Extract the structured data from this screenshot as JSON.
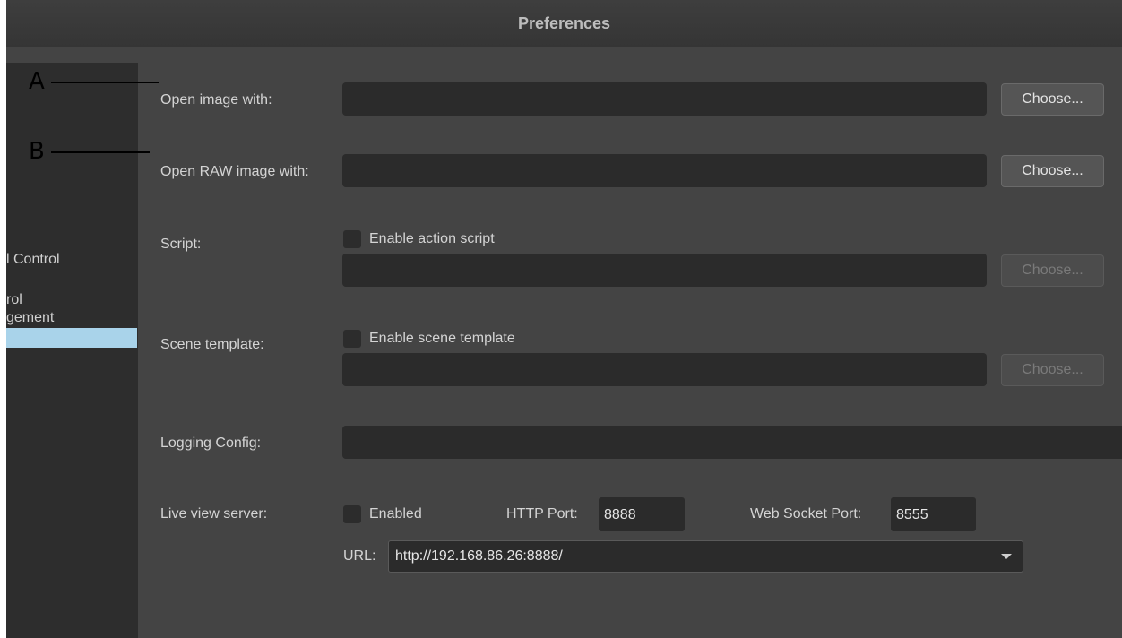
{
  "window": {
    "title": "Preferences"
  },
  "sidebar": {
    "items": [
      "l Control",
      "rol",
      "gement"
    ]
  },
  "rows": {
    "open_image": {
      "label": "Open image with:",
      "button": "Choose..."
    },
    "open_raw": {
      "label": "Open RAW image with:",
      "button": "Choose..."
    },
    "script": {
      "label": "Script:",
      "checkbox": "Enable action script",
      "button": "Choose..."
    },
    "scene": {
      "label": "Scene template:",
      "checkbox": "Enable scene template",
      "button": "Choose..."
    },
    "logging": {
      "label": "Logging Config:"
    },
    "live_view": {
      "label": "Live view server:",
      "enabled_label": "Enabled",
      "http_port_label": "HTTP Port:",
      "http_port": "8888",
      "ws_port_label": "Web Socket Port:",
      "ws_port": "8555",
      "url_label": "URL:",
      "url": "http://192.168.86.26:8888/"
    }
  },
  "callouts": {
    "a": "A",
    "b": "B"
  }
}
